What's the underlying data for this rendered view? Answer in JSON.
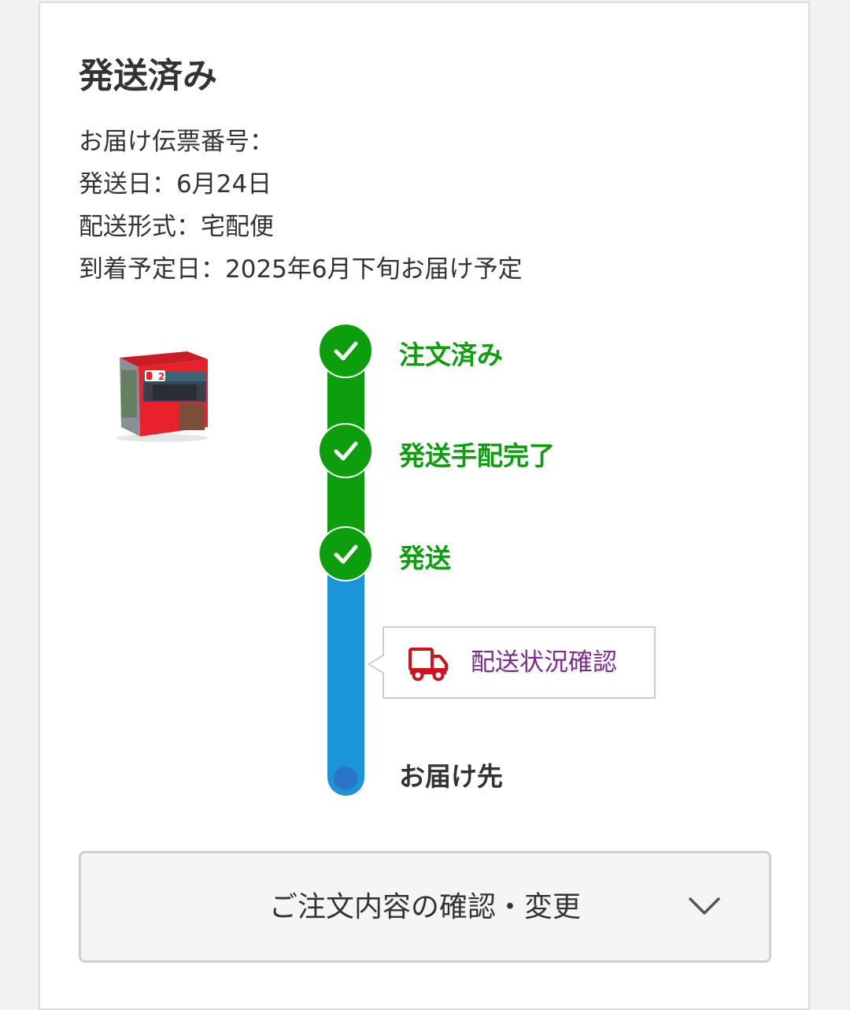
{
  "shipment": {
    "status_title": "発送済み",
    "info_lines": [
      "お届け伝票番号：",
      "発送日：6月24日",
      "配送形式：宅配便",
      "到着予定日：2025年6月下旬お届け予定"
    ]
  },
  "product": {
    "image_label": "2"
  },
  "timeline": {
    "steps": [
      {
        "label": "注文済み",
        "status": "complete"
      },
      {
        "label": "発送手配完了",
        "status": "complete"
      },
      {
        "label": "発送",
        "status": "complete"
      }
    ],
    "destination_label": "お届け先",
    "tracking_button_label": "配送状況確認",
    "tracking_icon": "truck-icon"
  },
  "order_detail": {
    "label": "ご注文内容の確認・変更",
    "icon": "chevron-down-icon"
  },
  "colors": {
    "complete_green": "#0d9e0d",
    "in_transit_blue": "#1a96d8",
    "destination_dot": "#2b74c7",
    "tracking_link_purple": "#7b2d8e",
    "truck_red": "#d0131b"
  }
}
